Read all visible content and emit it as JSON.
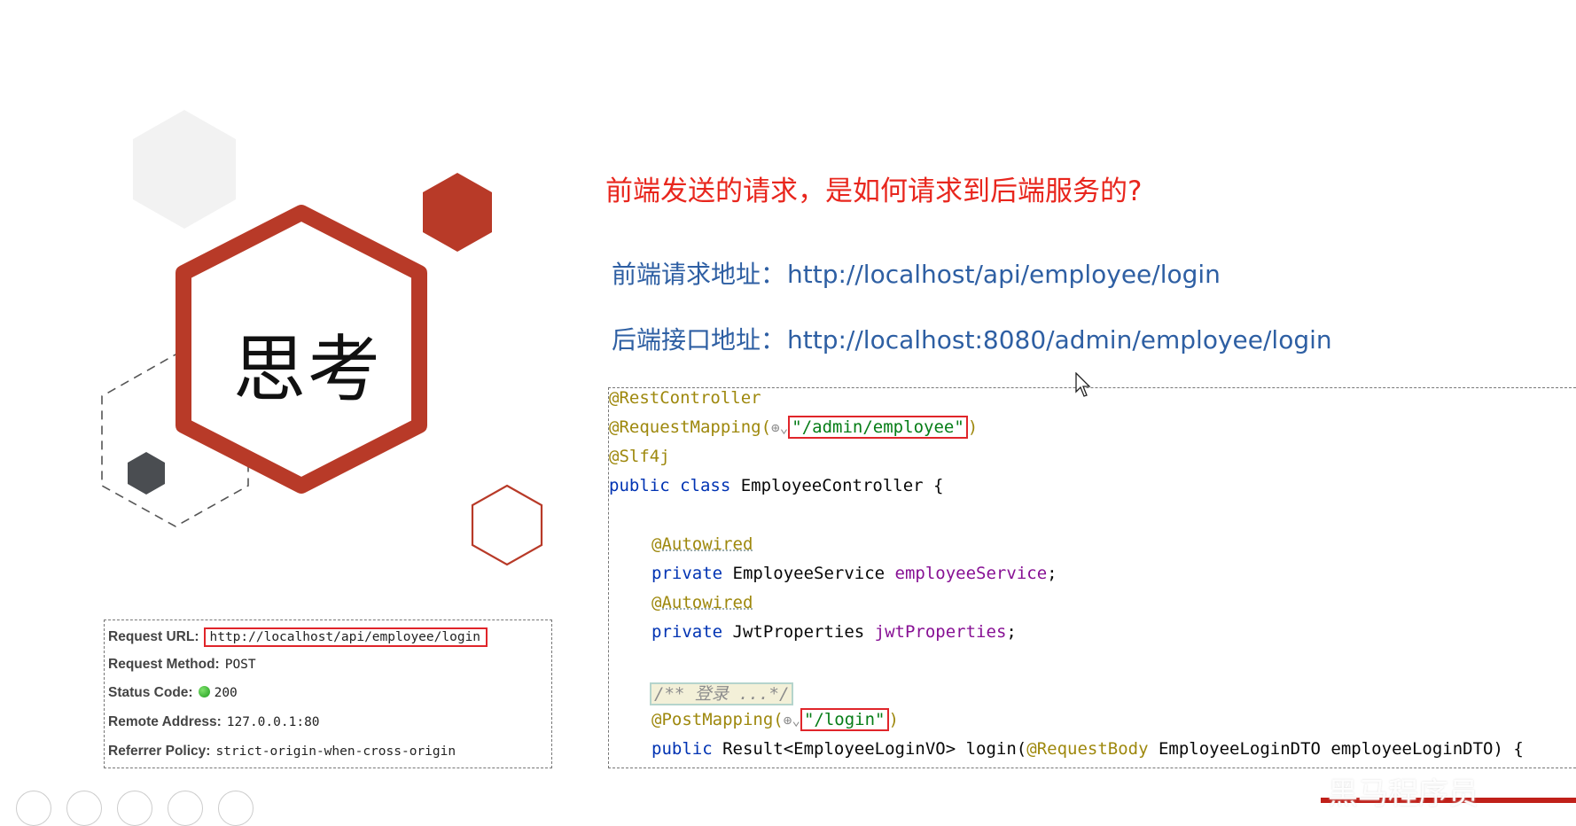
{
  "slide": {
    "think_label": "思考",
    "question": "前端发送的请求，是如何请求到后端服务的?",
    "frontend_label": "前端请求地址：",
    "frontend_url": "http://localhost/api/employee/login",
    "backend_label": "后端接口地址：",
    "backend_url": "http://localhost:8080/admin/employee/login"
  },
  "request_panel": {
    "url_key": "Request URL:",
    "url_value": "http://localhost/api/employee/login",
    "method_key": "Request Method:",
    "method_value": "POST",
    "status_key": "Status Code:",
    "status_value": "200",
    "remote_key": "Remote Address:",
    "remote_value": "127.0.0.1:80",
    "referrer_key": "Referrer Policy:",
    "referrer_value": "strict-origin-when-cross-origin"
  },
  "code": {
    "l1": "@RestController",
    "l2_ann": "@RequestMapping(",
    "l2_str": "\"/admin/employee\"",
    "l2_end": ")",
    "l3": "@Slf4j",
    "l4_kw": "public class ",
    "l4_name": "EmployeeController {",
    "l6": "@Autowired",
    "l7_kw": "private ",
    "l7_type": "EmployeeService ",
    "l7_field": "employeeService",
    "l7_end": ";",
    "l8": "@Autowired",
    "l9_kw": "private ",
    "l9_type": "JwtProperties ",
    "l9_field": "jwtProperties",
    "l9_end": ";",
    "l11": "/** 登录 ...*/",
    "l12_ann": "@PostMapping(",
    "l12_str": "\"/login\"",
    "l12_end": ")",
    "l13_kw": "public ",
    "l13_a": "Result<EmployeeLoginVO> login(",
    "l13_ann": "@RequestBody ",
    "l13_b": "EmployeeLoginDTO employeeLoginDTO) {"
  },
  "colors": {
    "accent_red": "#b83a28",
    "question_red": "#e8261d",
    "address_blue": "#2e5fa3",
    "highlight_box": "#e0252a"
  },
  "watermark": "黑马程序员"
}
